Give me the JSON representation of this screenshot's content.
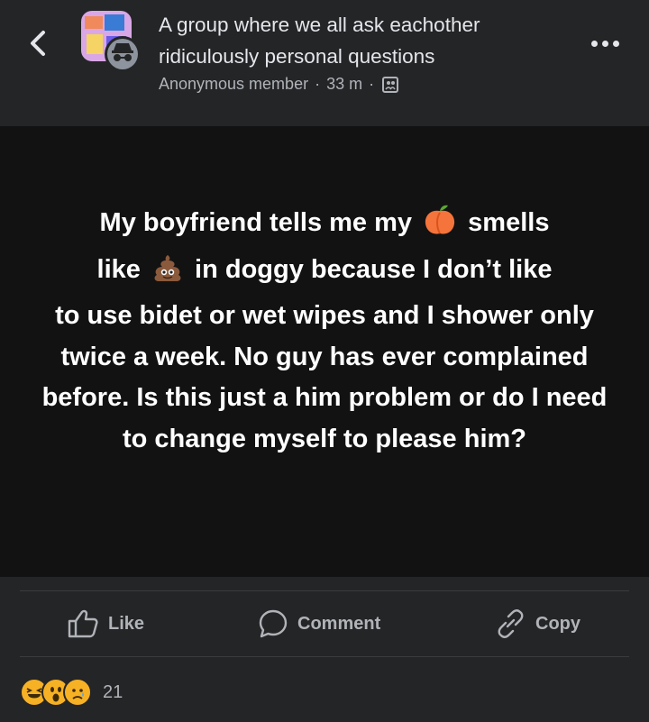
{
  "header": {
    "title": "A group where we all ask eachother ridiculously personal questions",
    "author": "Anonymous member",
    "separator": "·",
    "time": "33 m",
    "privacy_icon": "group-privacy-icon"
  },
  "post": {
    "line1_a": "My boyfriend tells me my",
    "line1_b": "smells",
    "line2_a": "like",
    "line2_b": "in doggy because I don’t like",
    "rest": "to use bidet or wet wipes and I shower only twice a week. No guy has ever complained before. Is this just a him problem or do I need to change myself to please him?",
    "emoji1": "peach-emoji",
    "emoji2": "poop-emoji",
    "background": "#121212"
  },
  "actions": {
    "like_label": "Like",
    "comment_label": "Comment",
    "copy_label": "Copy"
  },
  "reactions": {
    "icons": [
      "haha-emoji",
      "wow-emoji",
      "sad-emoji"
    ],
    "count": "21"
  },
  "colors": {
    "page_bg": "#242526",
    "text_primary": "#e4e6eb",
    "text_secondary": "#b0b3b8",
    "reaction_yellow": "#f7b125"
  }
}
